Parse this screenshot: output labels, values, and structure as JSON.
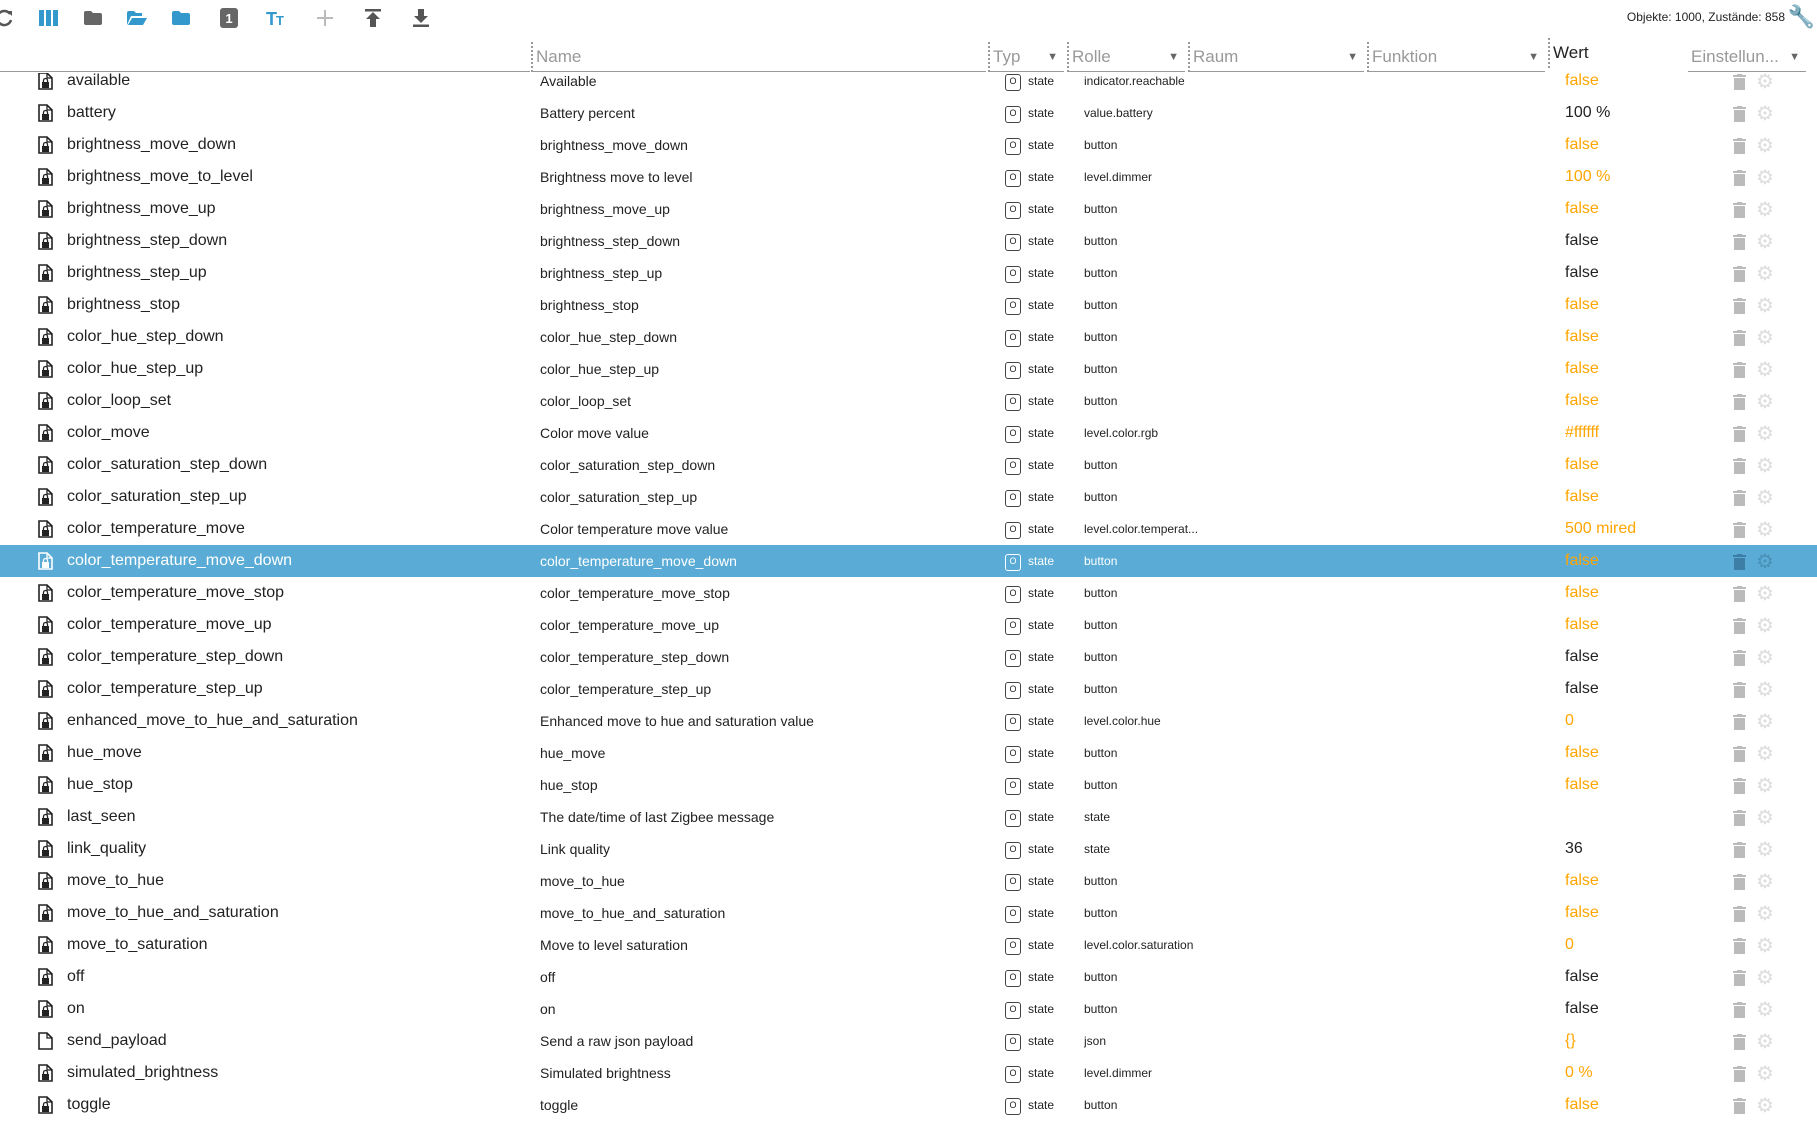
{
  "toolbar": {
    "icons": [
      "refresh-icon",
      "columns-icon",
      "folder-closed-icon",
      "folder-open-icon",
      "folder-icon",
      "number-one-icon",
      "text-size-icon",
      "plus-icon",
      "upload-icon",
      "download-icon"
    ],
    "stats": "Objekte: 1000, Zustände: 858"
  },
  "header": {
    "name": "Name",
    "typ": "Typ",
    "rolle": "Rolle",
    "raum": "Raum",
    "funktion": "Funktion",
    "wert": "Wert",
    "einstellungen": "Einstellun..."
  },
  "colors": {
    "accent": "#5aacd6",
    "orange": "#ffa500",
    "selected": "#5aacd6"
  },
  "selected_row": "color_temperature_move_down",
  "rows": [
    {
      "id": "available",
      "name": "Available",
      "type": "state",
      "role": "indicator.reachable",
      "value": "false",
      "color": "orange",
      "lock": true
    },
    {
      "id": "battery",
      "name": "Battery percent",
      "type": "state",
      "role": "value.battery",
      "value": "100 %",
      "color": "black",
      "lock": true
    },
    {
      "id": "brightness_move_down",
      "name": "brightness_move_down",
      "type": "state",
      "role": "button",
      "value": "false",
      "color": "orange",
      "lock": true
    },
    {
      "id": "brightness_move_to_level",
      "name": "Brightness move to level",
      "type": "state",
      "role": "level.dimmer",
      "value": "100 %",
      "color": "orange",
      "lock": true
    },
    {
      "id": "brightness_move_up",
      "name": "brightness_move_up",
      "type": "state",
      "role": "button",
      "value": "false",
      "color": "orange",
      "lock": true
    },
    {
      "id": "brightness_step_down",
      "name": "brightness_step_down",
      "type": "state",
      "role": "button",
      "value": "false",
      "color": "black",
      "lock": true
    },
    {
      "id": "brightness_step_up",
      "name": "brightness_step_up",
      "type": "state",
      "role": "button",
      "value": "false",
      "color": "black",
      "lock": true
    },
    {
      "id": "brightness_stop",
      "name": "brightness_stop",
      "type": "state",
      "role": "button",
      "value": "false",
      "color": "orange",
      "lock": true
    },
    {
      "id": "color_hue_step_down",
      "name": "color_hue_step_down",
      "type": "state",
      "role": "button",
      "value": "false",
      "color": "orange",
      "lock": true
    },
    {
      "id": "color_hue_step_up",
      "name": "color_hue_step_up",
      "type": "state",
      "role": "button",
      "value": "false",
      "color": "orange",
      "lock": true
    },
    {
      "id": "color_loop_set",
      "name": "color_loop_set",
      "type": "state",
      "role": "button",
      "value": "false",
      "color": "orange",
      "lock": true
    },
    {
      "id": "color_move",
      "name": "Color move value",
      "type": "state",
      "role": "level.color.rgb",
      "value": "#ffffff",
      "color": "orange",
      "lock": true
    },
    {
      "id": "color_saturation_step_down",
      "name": "color_saturation_step_down",
      "type": "state",
      "role": "button",
      "value": "false",
      "color": "orange",
      "lock": true
    },
    {
      "id": "color_saturation_step_up",
      "name": "color_saturation_step_up",
      "type": "state",
      "role": "button",
      "value": "false",
      "color": "orange",
      "lock": true
    },
    {
      "id": "color_temperature_move",
      "name": "Color temperature move value",
      "type": "state",
      "role": "level.color.temperat...",
      "value": "500 mired",
      "color": "orange",
      "lock": true
    },
    {
      "id": "color_temperature_move_down",
      "name": "color_temperature_move_down",
      "type": "state",
      "role": "button",
      "value": "false",
      "color": "orange",
      "lock": true
    },
    {
      "id": "color_temperature_move_stop",
      "name": "color_temperature_move_stop",
      "type": "state",
      "role": "button",
      "value": "false",
      "color": "orange",
      "lock": true
    },
    {
      "id": "color_temperature_move_up",
      "name": "color_temperature_move_up",
      "type": "state",
      "role": "button",
      "value": "false",
      "color": "orange",
      "lock": true
    },
    {
      "id": "color_temperature_step_down",
      "name": "color_temperature_step_down",
      "type": "state",
      "role": "button",
      "value": "false",
      "color": "black",
      "lock": true
    },
    {
      "id": "color_temperature_step_up",
      "name": "color_temperature_step_up",
      "type": "state",
      "role": "button",
      "value": "false",
      "color": "black",
      "lock": true
    },
    {
      "id": "enhanced_move_to_hue_and_saturation",
      "name": "Enhanced move to hue and saturation value",
      "type": "state",
      "role": "level.color.hue",
      "value": "0",
      "color": "orange",
      "lock": true
    },
    {
      "id": "hue_move",
      "name": "hue_move",
      "type": "state",
      "role": "button",
      "value": "false",
      "color": "orange",
      "lock": true
    },
    {
      "id": "hue_stop",
      "name": "hue_stop",
      "type": "state",
      "role": "button",
      "value": "false",
      "color": "orange",
      "lock": true
    },
    {
      "id": "last_seen",
      "name": "The date/time of last Zigbee message",
      "type": "state",
      "role": "state",
      "value": "",
      "color": "black",
      "lock": true
    },
    {
      "id": "link_quality",
      "name": "Link quality",
      "type": "state",
      "role": "state",
      "value": "36",
      "color": "black",
      "lock": true
    },
    {
      "id": "move_to_hue",
      "name": "move_to_hue",
      "type": "state",
      "role": "button",
      "value": "false",
      "color": "orange",
      "lock": true
    },
    {
      "id": "move_to_hue_and_saturation",
      "name": "move_to_hue_and_saturation",
      "type": "state",
      "role": "button",
      "value": "false",
      "color": "orange",
      "lock": true
    },
    {
      "id": "move_to_saturation",
      "name": "Move to level saturation",
      "type": "state",
      "role": "level.color.saturation",
      "value": "0",
      "color": "orange",
      "lock": true
    },
    {
      "id": "off",
      "name": "off",
      "type": "state",
      "role": "button",
      "value": "false",
      "color": "black",
      "lock": true
    },
    {
      "id": "on",
      "name": "on",
      "type": "state",
      "role": "button",
      "value": "false",
      "color": "black",
      "lock": true
    },
    {
      "id": "send_payload",
      "name": "Send a raw json payload",
      "type": "state",
      "role": "json",
      "value": "{}",
      "color": "orange",
      "lock": false
    },
    {
      "id": "simulated_brightness",
      "name": "Simulated brightness",
      "type": "state",
      "role": "level.dimmer",
      "value": "0 %",
      "color": "orange",
      "lock": true
    },
    {
      "id": "toggle",
      "name": "toggle",
      "type": "state",
      "role": "button",
      "value": "false",
      "color": "orange",
      "lock": true
    }
  ]
}
